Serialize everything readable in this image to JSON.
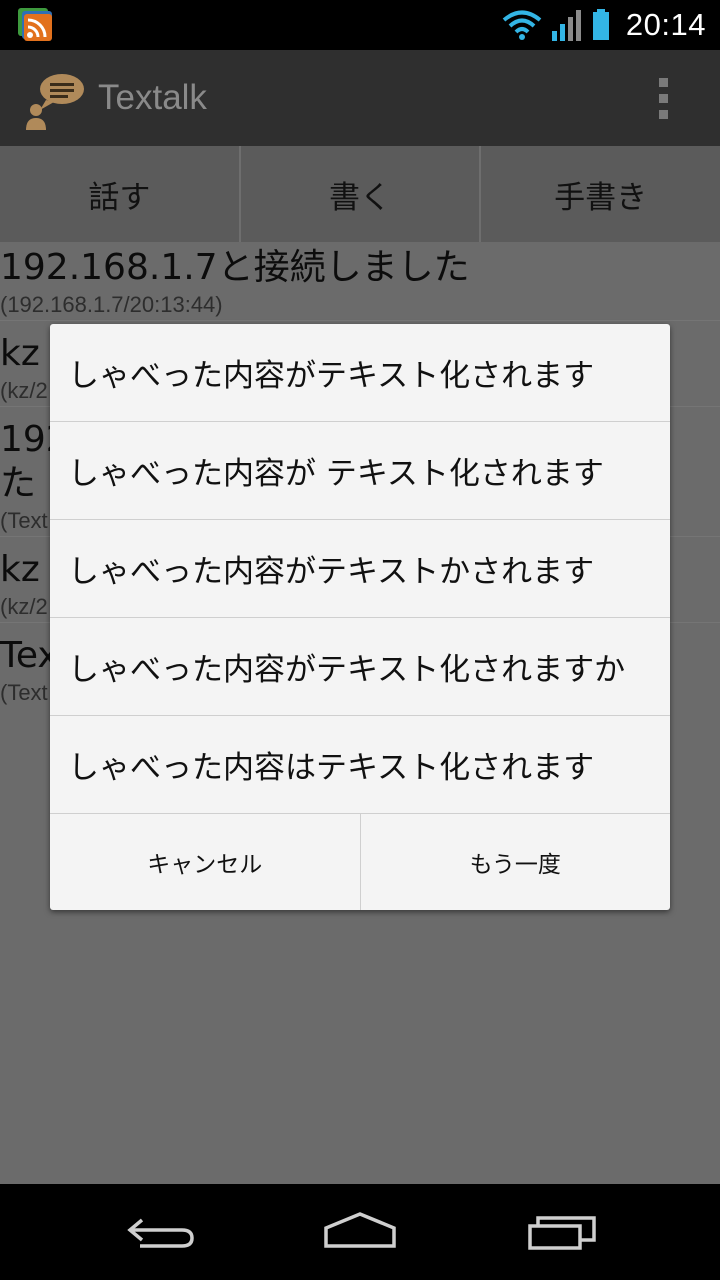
{
  "status_bar": {
    "time": "20:14",
    "icons": [
      "rss-notification-icon",
      "wifi-icon",
      "signal-icon",
      "battery-icon"
    ]
  },
  "action_bar": {
    "title": "Textalk",
    "icons": [
      "speech-bubble-logo-icon",
      "overflow-menu-icon"
    ]
  },
  "tabs": [
    {
      "label": "話す"
    },
    {
      "label": "書く"
    },
    {
      "label": "手書き"
    }
  ],
  "messages": [
    {
      "main": "192.168.1.7と接続しました",
      "sub": "(192.168.1.7/20:13:44)"
    },
    {
      "main": "kz",
      "sub": "(kz/2"
    },
    {
      "main": "192",
      "main2": "た",
      "sub": "(Text"
    },
    {
      "main": "kz",
      "sub": "(kz/2"
    },
    {
      "main": "Tex",
      "sub": "(Text"
    }
  ],
  "dialog": {
    "options": [
      "しゃべった内容がテキスト化されます",
      "しゃべった内容が テキスト化されます",
      "しゃべった内容がテキストかされます",
      "しゃべった内容がテキスト化されますか",
      "しゃべった内容はテキスト化されます"
    ],
    "cancel_label": "キャンセル",
    "retry_label": "もう一度"
  },
  "nav_bar": {
    "icons": [
      "back-icon",
      "home-icon",
      "recent-apps-icon"
    ]
  },
  "colors": {
    "dim_overlay": "#6b6b6b",
    "accent_wifi": "#33b5e5",
    "dialog_bg": "#f4f4f4"
  }
}
